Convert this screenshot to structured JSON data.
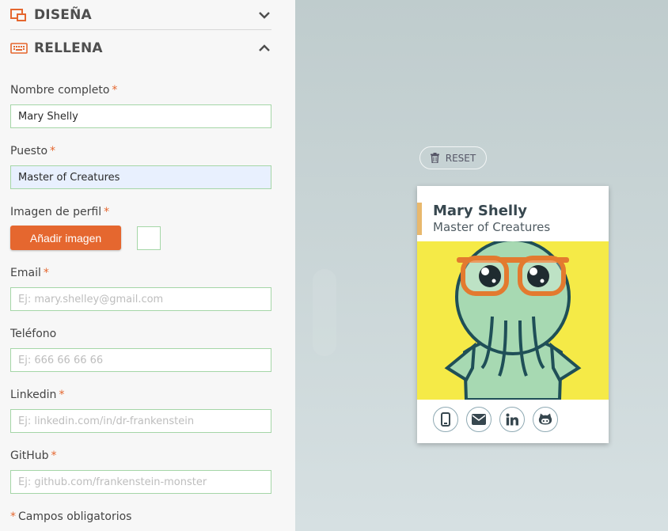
{
  "sections": {
    "design_title": "DISEÑA",
    "fill_title": "RELLENA"
  },
  "form": {
    "name_label": "Nombre completo",
    "name_value": "Mary Shelly",
    "job_label": "Puesto",
    "job_value": "Master of Creatures",
    "image_label": "Imagen de perfil",
    "add_image_button": "Añadir imagen",
    "email_label": "Email",
    "email_placeholder": "Ej: mary.shelley@gmail.com",
    "phone_label": "Teléfono",
    "phone_placeholder": "Ej: 666 66 66 66",
    "linkedin_label": "Linkedin",
    "linkedin_placeholder": "Ej: linkedin.com/in/dr-frankenstein",
    "github_label": "GitHub",
    "github_placeholder": "Ej: github.com/frankenstein-monster",
    "required_marker": "*",
    "required_note": "Campos obligatorios"
  },
  "preview": {
    "reset_label": "RESET",
    "card_name": "Mary Shelly",
    "card_job": "Master of Creatures",
    "social_icons": [
      "phone-icon",
      "email-icon",
      "linkedin-icon",
      "github-icon"
    ]
  },
  "colors": {
    "accent": "#e5672f",
    "field_border": "#a5d6a7",
    "card_bar": "#e8b86d",
    "card_photo_bg": "#f5ea47",
    "card_text": "#37474f"
  }
}
